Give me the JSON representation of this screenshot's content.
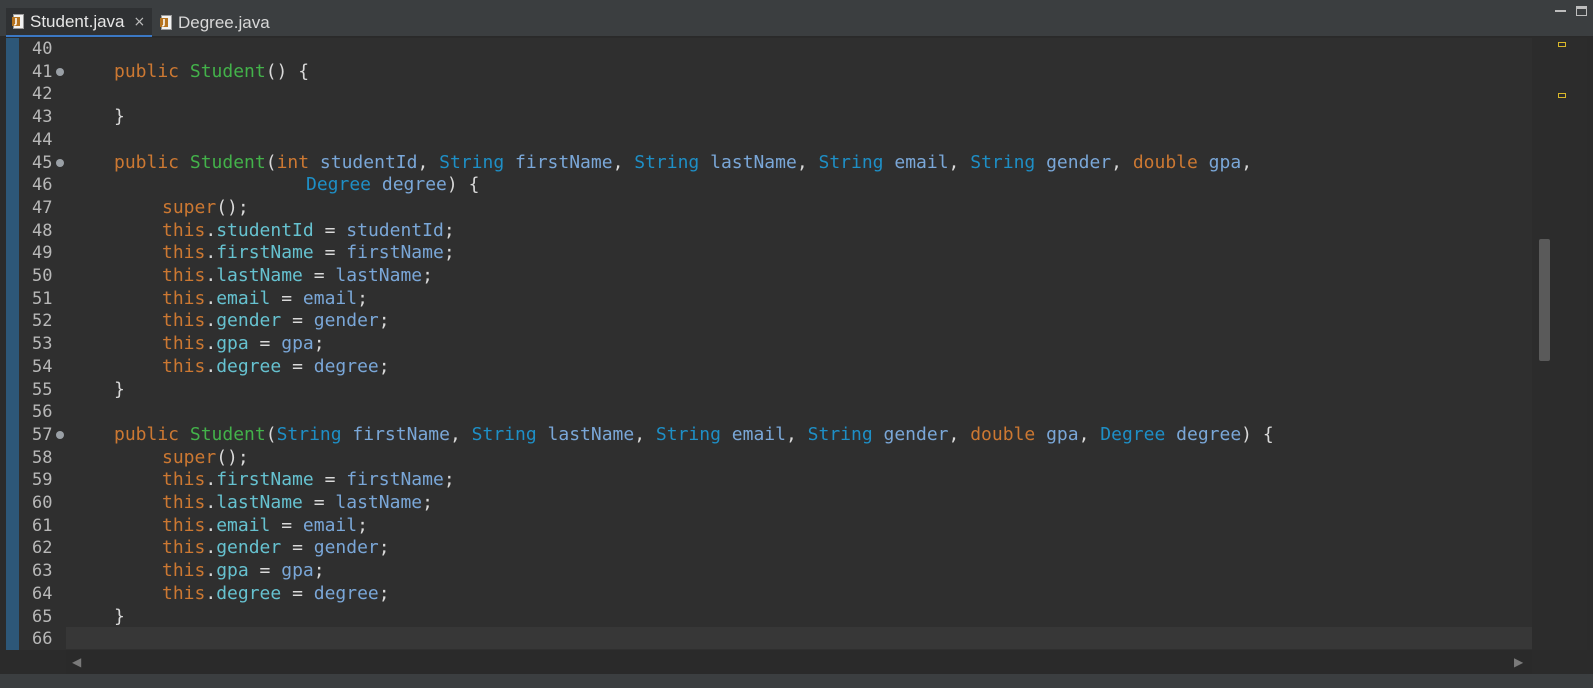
{
  "tabs": [
    {
      "label": "Student.java",
      "active": true,
      "icon": "java-file-icon"
    },
    {
      "label": "Degree.java",
      "active": false,
      "icon": "java-file-icon"
    }
  ],
  "close_glyph": "×",
  "scroll": {
    "left_glyph": "◀",
    "right_glyph": "▶"
  },
  "colors": {
    "keyword": "#cc7832",
    "type": "#1e8fc6",
    "constructor": "#43b24a",
    "variable": "#7aa7d8",
    "field": "#66c2d0",
    "background": "#2f2f2f"
  },
  "editor": {
    "lines": [
      {
        "n": "40",
        "fold": false,
        "indent": 0,
        "tokens": []
      },
      {
        "n": "41",
        "fold": true,
        "indent": 0,
        "tokens": [
          [
            "kw",
            "public "
          ],
          [
            "ctor",
            "Student"
          ],
          [
            "pn",
            "() {"
          ]
        ]
      },
      {
        "n": "42",
        "fold": false,
        "indent": 0,
        "tokens": []
      },
      {
        "n": "43",
        "fold": false,
        "indent": 0,
        "tokens": [
          [
            "pn",
            "}"
          ]
        ]
      },
      {
        "n": "44",
        "fold": false,
        "indent": 0,
        "tokens": []
      },
      {
        "n": "45",
        "fold": true,
        "indent": 0,
        "tokens": [
          [
            "kw",
            "public "
          ],
          [
            "ctor",
            "Student"
          ],
          [
            "pn",
            "("
          ],
          [
            "kw",
            "int "
          ],
          [
            "var",
            "studentId"
          ],
          [
            "pn",
            ", "
          ],
          [
            "ty",
            "String "
          ],
          [
            "var",
            "firstName"
          ],
          [
            "pn",
            ", "
          ],
          [
            "ty",
            "String "
          ],
          [
            "var",
            "lastName"
          ],
          [
            "pn",
            ", "
          ],
          [
            "ty",
            "String "
          ],
          [
            "var",
            "email"
          ],
          [
            "pn",
            ", "
          ],
          [
            "ty",
            "String "
          ],
          [
            "var",
            "gender"
          ],
          [
            "pn",
            ", "
          ],
          [
            "kw",
            "double "
          ],
          [
            "var",
            "gpa"
          ],
          [
            "pn",
            ","
          ]
        ]
      },
      {
        "n": "46",
        "fold": false,
        "indent": 4,
        "tokens": [
          [
            "ty",
            "Degree "
          ],
          [
            "var",
            "degree"
          ],
          [
            "pn",
            ") {"
          ]
        ]
      },
      {
        "n": "47",
        "fold": false,
        "indent": 1,
        "tokens": [
          [
            "kw",
            "super"
          ],
          [
            "pn",
            "();"
          ]
        ]
      },
      {
        "n": "48",
        "fold": false,
        "indent": 1,
        "tokens": [
          [
            "kw",
            "this"
          ],
          [
            "pn",
            "."
          ],
          [
            "fld",
            "studentId"
          ],
          [
            "pn",
            " = "
          ],
          [
            "var",
            "studentId"
          ],
          [
            "pn",
            ";"
          ]
        ]
      },
      {
        "n": "49",
        "fold": false,
        "indent": 1,
        "tokens": [
          [
            "kw",
            "this"
          ],
          [
            "pn",
            "."
          ],
          [
            "fld",
            "firstName"
          ],
          [
            "pn",
            " = "
          ],
          [
            "var",
            "firstName"
          ],
          [
            "pn",
            ";"
          ]
        ]
      },
      {
        "n": "50",
        "fold": false,
        "indent": 1,
        "tokens": [
          [
            "kw",
            "this"
          ],
          [
            "pn",
            "."
          ],
          [
            "fld",
            "lastName"
          ],
          [
            "pn",
            " = "
          ],
          [
            "var",
            "lastName"
          ],
          [
            "pn",
            ";"
          ]
        ]
      },
      {
        "n": "51",
        "fold": false,
        "indent": 1,
        "tokens": [
          [
            "kw",
            "this"
          ],
          [
            "pn",
            "."
          ],
          [
            "fld",
            "email"
          ],
          [
            "pn",
            " = "
          ],
          [
            "var",
            "email"
          ],
          [
            "pn",
            ";"
          ]
        ]
      },
      {
        "n": "52",
        "fold": false,
        "indent": 1,
        "tokens": [
          [
            "kw",
            "this"
          ],
          [
            "pn",
            "."
          ],
          [
            "fld",
            "gender"
          ],
          [
            "pn",
            " = "
          ],
          [
            "var",
            "gender"
          ],
          [
            "pn",
            ";"
          ]
        ]
      },
      {
        "n": "53",
        "fold": false,
        "indent": 1,
        "tokens": [
          [
            "kw",
            "this"
          ],
          [
            "pn",
            "."
          ],
          [
            "fld",
            "gpa"
          ],
          [
            "pn",
            " = "
          ],
          [
            "var",
            "gpa"
          ],
          [
            "pn",
            ";"
          ]
        ]
      },
      {
        "n": "54",
        "fold": false,
        "indent": 1,
        "tokens": [
          [
            "kw",
            "this"
          ],
          [
            "pn",
            "."
          ],
          [
            "fld",
            "degree"
          ],
          [
            "pn",
            " = "
          ],
          [
            "var",
            "degree"
          ],
          [
            "pn",
            ";"
          ]
        ]
      },
      {
        "n": "55",
        "fold": false,
        "indent": 0,
        "tokens": [
          [
            "pn",
            "}"
          ]
        ]
      },
      {
        "n": "56",
        "fold": false,
        "indent": 0,
        "tokens": []
      },
      {
        "n": "57",
        "fold": true,
        "indent": 0,
        "tokens": [
          [
            "kw",
            "public "
          ],
          [
            "ctor",
            "Student"
          ],
          [
            "pn",
            "("
          ],
          [
            "ty",
            "String "
          ],
          [
            "var",
            "firstName"
          ],
          [
            "pn",
            ", "
          ],
          [
            "ty",
            "String "
          ],
          [
            "var",
            "lastName"
          ],
          [
            "pn",
            ", "
          ],
          [
            "ty",
            "String "
          ],
          [
            "var",
            "email"
          ],
          [
            "pn",
            ", "
          ],
          [
            "ty",
            "String "
          ],
          [
            "var",
            "gender"
          ],
          [
            "pn",
            ", "
          ],
          [
            "kw",
            "double "
          ],
          [
            "var",
            "gpa"
          ],
          [
            "pn",
            ", "
          ],
          [
            "ty",
            "Degree "
          ],
          [
            "var",
            "degree"
          ],
          [
            "pn",
            ") {"
          ]
        ]
      },
      {
        "n": "58",
        "fold": false,
        "indent": 1,
        "tokens": [
          [
            "kw",
            "super"
          ],
          [
            "pn",
            "();"
          ]
        ]
      },
      {
        "n": "59",
        "fold": false,
        "indent": 1,
        "tokens": [
          [
            "kw",
            "this"
          ],
          [
            "pn",
            "."
          ],
          [
            "fld",
            "firstName"
          ],
          [
            "pn",
            " = "
          ],
          [
            "var",
            "firstName"
          ],
          [
            "pn",
            ";"
          ]
        ]
      },
      {
        "n": "60",
        "fold": false,
        "indent": 1,
        "tokens": [
          [
            "kw",
            "this"
          ],
          [
            "pn",
            "."
          ],
          [
            "fld",
            "lastName"
          ],
          [
            "pn",
            " = "
          ],
          [
            "var",
            "lastName"
          ],
          [
            "pn",
            ";"
          ]
        ]
      },
      {
        "n": "61",
        "fold": false,
        "indent": 1,
        "tokens": [
          [
            "kw",
            "this"
          ],
          [
            "pn",
            "."
          ],
          [
            "fld",
            "email"
          ],
          [
            "pn",
            " = "
          ],
          [
            "var",
            "email"
          ],
          [
            "pn",
            ";"
          ]
        ]
      },
      {
        "n": "62",
        "fold": false,
        "indent": 1,
        "tokens": [
          [
            "kw",
            "this"
          ],
          [
            "pn",
            "."
          ],
          [
            "fld",
            "gender"
          ],
          [
            "pn",
            " = "
          ],
          [
            "var",
            "gender"
          ],
          [
            "pn",
            ";"
          ]
        ]
      },
      {
        "n": "63",
        "fold": false,
        "indent": 1,
        "tokens": [
          [
            "kw",
            "this"
          ],
          [
            "pn",
            "."
          ],
          [
            "fld",
            "gpa"
          ],
          [
            "pn",
            " = "
          ],
          [
            "var",
            "gpa"
          ],
          [
            "pn",
            ";"
          ]
        ]
      },
      {
        "n": "64",
        "fold": false,
        "indent": 1,
        "tokens": [
          [
            "kw",
            "this"
          ],
          [
            "pn",
            "."
          ],
          [
            "fld",
            "degree"
          ],
          [
            "pn",
            " = "
          ],
          [
            "var",
            "degree"
          ],
          [
            "pn",
            ";"
          ]
        ]
      },
      {
        "n": "65",
        "fold": false,
        "indent": 0,
        "tokens": [
          [
            "pn",
            "}"
          ]
        ]
      },
      {
        "n": "66",
        "fold": false,
        "indent": 0,
        "tokens": []
      }
    ]
  }
}
